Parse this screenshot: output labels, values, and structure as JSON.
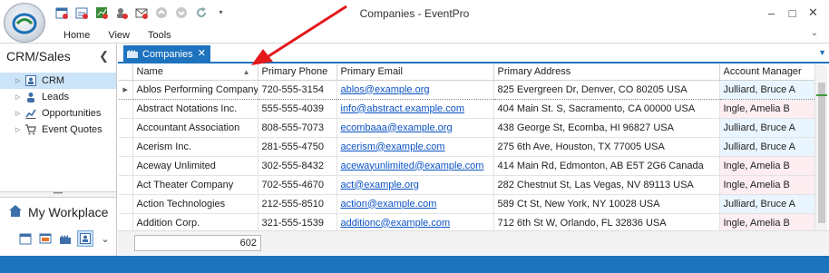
{
  "window": {
    "title": "Companies - EventPro"
  },
  "menu": {
    "items": [
      "Home",
      "View",
      "Tools"
    ]
  },
  "left_nav": {
    "header": "CRM/Sales",
    "items": [
      {
        "label": "CRM",
        "icon": "contact-card-icon",
        "selected": true
      },
      {
        "label": "Leads",
        "icon": "person-icon",
        "selected": false
      },
      {
        "label": "Opportunities",
        "icon": "chart-icon",
        "selected": false
      },
      {
        "label": "Event Quotes",
        "icon": "cart-icon",
        "selected": false
      }
    ],
    "workplace_label": "My Workplace"
  },
  "tab": {
    "label": "Companies"
  },
  "grid": {
    "columns": [
      "Name",
      "Primary Phone",
      "Primary Email",
      "Primary Address",
      "Account Manager"
    ],
    "rows": [
      [
        "Ablos Performing Company",
        "720-555-3154",
        "ablos@example.org",
        "825 Evergreen Dr, Denver, CO 80205 USA",
        "Julliard, Bruce A"
      ],
      [
        "Abstract Notations Inc.",
        "555-555-4039",
        "info@abstract.example.com",
        "404 Main St. S, Sacramento, CA 00000 USA",
        "Ingle, Amelia B"
      ],
      [
        "Accountant Association",
        "808-555-7073",
        "ecombaaa@example.org",
        "438 George St, Ecomba, HI 96827 USA",
        "Julliard, Bruce A"
      ],
      [
        "Acerism Inc.",
        "281-555-4750",
        "acerism@example.com",
        "275 6th Ave, Houston, TX 77005 USA",
        "Julliard, Bruce A"
      ],
      [
        "Aceway Unlimited",
        "302-555-8432",
        "acewayunlimited@example.com",
        "414 Main Rd, Edmonton, AB E5T 2G6 Canada",
        "Ingle, Amelia B"
      ],
      [
        "Act Theater Company",
        "702-555-4670",
        "act@example.org",
        "282 Chestnut St, Las Vegas, NV 89113 USA",
        "Ingle, Amelia B"
      ],
      [
        "Action Technologies",
        "212-555-8510",
        "action@example.com",
        "589 Ct St, New York, NY 10028 USA",
        "Julliard, Bruce A"
      ],
      [
        "Addition Corp.",
        "321-555-1539",
        "additionc@example.com",
        "712 6th St W, Orlando, FL 32836 USA",
        "Ingle, Amelia B"
      ]
    ],
    "record_count": "602",
    "sort_column": "Name",
    "sort_direction": "ascending"
  },
  "colors": {
    "accent": "#1e73be",
    "annotation_arrow": "#e3191c",
    "selection": "#cce4f7"
  }
}
